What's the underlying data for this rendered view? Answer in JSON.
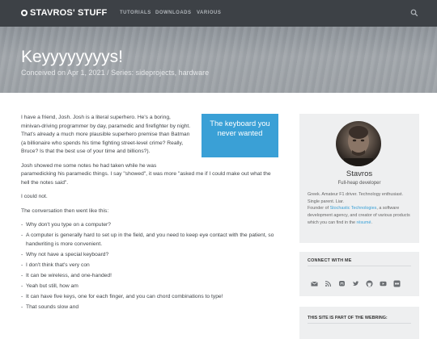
{
  "header": {
    "logo_text": "STAVROS' STUFF",
    "nav": [
      "TUTORIALS",
      "DOWNLOADS",
      "VARIOUS"
    ]
  },
  "hero": {
    "title": "Keyyyyyyyys!",
    "meta": "Conceived on Apr 1, 2021 / Series: sideprojects, hardware"
  },
  "article": {
    "pullquote": "The keyboard you never wanted",
    "p1": "I have a friend, Josh. Josh is a literal superhero. He's a boring, minivan-driving programmer by day, paramedic and firefighter by night. That's already a much more plausible superhero premise than Batman (a billionaire who spends his time fighting street-level crime? Really, Bruce? Is that the best use of your time and billions?).",
    "p2": "Josh showed me some notes he had taken while he was paramedicking his paramedic things. I say \"showed\", it was more \"asked me if I could make out what the hell the notes said\".",
    "p3": "I could not.",
    "p4": "The conversation then went like this:",
    "dialogue": [
      "Why don't you type on a computer?",
      "A computer is generally hard to set up in the field, and you need to keep eye contact with the patient, so handwriting is more convenient.",
      "Why not have a special keyboard?",
      "I don't think that's very con",
      "It can be wireless, and one-handed!",
      "Yeah but still, how am",
      "It can have five keys, one for each finger, and you can chord combinations to type!",
      "That sounds slow and"
    ]
  },
  "sidebar": {
    "author_name": "Stavros",
    "author_role": "Full-heap developer",
    "bio_1": "Greek. Amateur F1 driver. Technology enthusiast. Single parent. Liar.",
    "bio_2a": "Founder of ",
    "bio_link1": "Stochastic Technologies",
    "bio_2b": ", a software development agency, and creator of various products which you can find in the ",
    "bio_link2": "résumé",
    "bio_2c": ".",
    "connect_title": "CONNECT WITH ME",
    "social_icons": [
      "mail-icon",
      "rss-icon",
      "mastodon-icon",
      "twitter-icon",
      "github-icon",
      "youtube-icon",
      "flickr-icon"
    ],
    "webring_title": "THIS SITE IS PART OF THE WEBRING:"
  },
  "colors": {
    "topbar": "#3d4146",
    "accent": "#3aa0d6"
  }
}
